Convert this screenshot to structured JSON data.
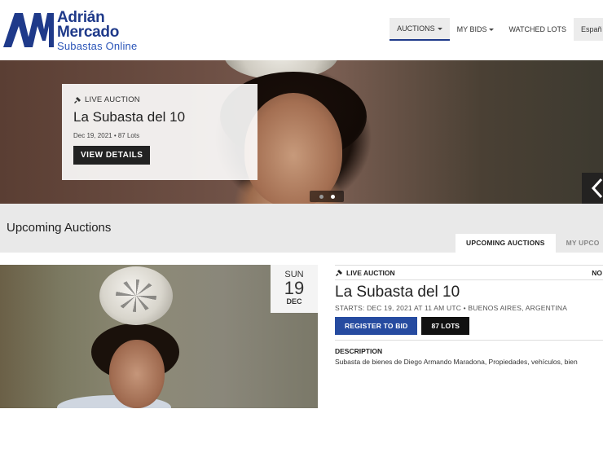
{
  "header": {
    "logo": {
      "line1": "Adrián",
      "line2": "Mercado",
      "line3": "Subastas Online",
      "mark": "AM"
    },
    "nav": {
      "auctions": "AUCTIONS",
      "my_bids": "MY BIDS",
      "watched_lots": "WATCHED LOTS",
      "language": "Españ"
    }
  },
  "hero": {
    "badge": "LIVE AUCTION",
    "title": "La Subasta del 10",
    "meta": "Dec 19, 2021 • 87 Lots",
    "button": "VIEW DETAILS",
    "slide_count": 2,
    "active_slide": 2
  },
  "upcoming": {
    "title": "Upcoming Auctions",
    "tabs": [
      "UPCOMING AUCTIONS",
      "MY UPCO"
    ]
  },
  "auction": {
    "date": {
      "dow": "SUN",
      "day": "19",
      "month": "DEC"
    },
    "badge": "LIVE AUCTION",
    "lot_no": "NO",
    "title": "La Subasta del 10",
    "starts": "STARTS: DEC 19, 2021 AT 11 AM UTC • BUENOS AIRES, ARGENTINA",
    "register_button": "REGISTER TO BID",
    "lots_button": "87 LOTS",
    "description_label": "DESCRIPTION",
    "description": "Subasta de bienes de Diego Armando Maradona, Propiedades, vehículos, bien"
  },
  "colors": {
    "brand_blue": "#1f3a8a",
    "button_blue": "#264ba0"
  }
}
